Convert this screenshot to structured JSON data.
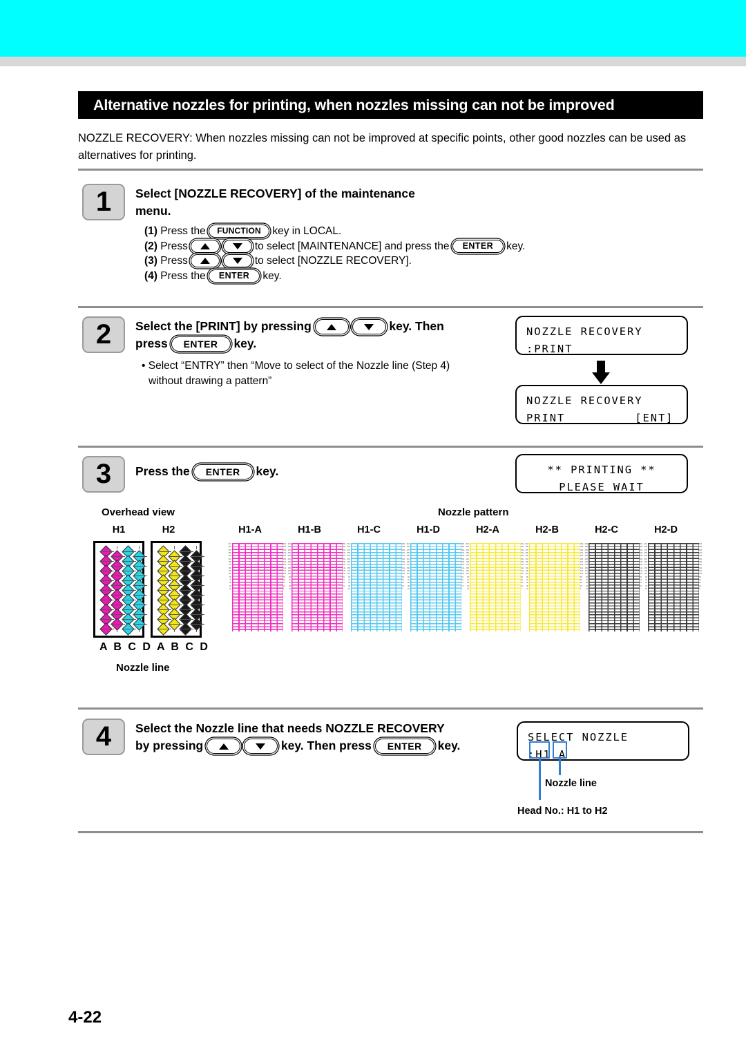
{
  "page": {
    "number": "4-22",
    "title": "Alternative nozzles for printing, when nozzles missing can not be improved",
    "intro": "NOZZLE RECOVERY: When nozzles missing can not be improved at specific points, other good nozzles can be used as alternatives for printing.",
    "banner_color": "#00ffff",
    "title_bg": "#000000",
    "accent_blue": "#2e7fd4"
  },
  "keys": {
    "function": "FUNCTION",
    "enter": "ENTER",
    "up": "▲",
    "down": "▼"
  },
  "steps": [
    {
      "num": "1",
      "heading_line1": "Select   [NOZZLE   RECOVERY]   of   the   maintenance",
      "heading_line2": "menu.",
      "substeps": [
        {
          "n": "(1)",
          "pre": "Press the",
          "key": "FUNCTION",
          "post": "key in LOCAL."
        },
        {
          "n": "(2)",
          "pre": "Press",
          "key": "arrows",
          "mid": "to select [MAINTENANCE] and press the",
          "key2": "ENTER",
          "post": "key."
        },
        {
          "n": "(3)",
          "pre": "Press",
          "key": "arrows",
          "post": "to select [NOZZLE RECOVERY]."
        },
        {
          "n": "(4)",
          "pre": "Press the",
          "key": "ENTER",
          "post": "key."
        }
      ]
    },
    {
      "num": "2",
      "heading_pre": "Select the [PRINT] by pressing",
      "heading_mid": "key.   Then",
      "heading_line2_pre": "press",
      "heading_line2_post": "key.",
      "note_line1": "• Select “ENTRY” then “Move  to  select  of  the  Nozzle  line  (Step  4)",
      "note_line2": "without drawing a pattern”",
      "lcd1": {
        "line1": "NOZZLE RECOVERY",
        "line2": ":PRINT"
      },
      "lcd2": {
        "line1": "NOZZLE RECOVERY",
        "line2": "PRINT         [ENT]"
      }
    },
    {
      "num": "3",
      "heading_pre": "Press the",
      "heading_post": "key.",
      "lcd": {
        "line1": "** PRINTING **",
        "line2": "PLEASE WAIT"
      }
    },
    {
      "num": "4",
      "heading_line1": "Select the Nozzle line that needs NOZZLE RECOVERY",
      "heading_line2_pre": "by pressing",
      "heading_line2_mid": "key. Then press",
      "heading_line2_post": "key.",
      "lcd": {
        "line1": "SELECT NOZZLE",
        "line2": ":H1 A"
      },
      "callouts": {
        "nozzle_line": "Nozzle line",
        "head_no": "Head No.: H1 to H2",
        "highlight_head": "H1",
        "highlight_line": "A"
      }
    }
  ],
  "figure": {
    "overhead_caption": "Overhead view",
    "pattern_caption": "Nozzle pattern",
    "nozzle_line_caption": "Nozzle line",
    "heads": [
      {
        "label": "H1",
        "abcd": "A B C D",
        "columns": [
          {
            "line": "A",
            "color": "#ea18b4"
          },
          {
            "line": "B",
            "color": "#ea18b4"
          },
          {
            "line": "C",
            "color": "#2ad4e8"
          },
          {
            "line": "D",
            "color": "#2ad4e8"
          }
        ]
      },
      {
        "label": "H2",
        "abcd": "A B C D",
        "columns": [
          {
            "line": "A",
            "color": "#f2e616"
          },
          {
            "line": "B",
            "color": "#f2e616"
          },
          {
            "line": "C",
            "color": "#1a1a1a"
          },
          {
            "line": "D",
            "color": "#1a1a1a"
          }
        ]
      }
    ],
    "patterns": [
      {
        "label": "H1-A",
        "color": "#ef2fbe"
      },
      {
        "label": "H1-B",
        "color": "#ef2fbe"
      },
      {
        "label": "H1-C",
        "color": "#55c8f0"
      },
      {
        "label": "H1-D",
        "color": "#55c8f0"
      },
      {
        "label": "H2-A",
        "color": "#f7e93c"
      },
      {
        "label": "H2-B",
        "color": "#f7e93c"
      },
      {
        "label": "H2-C",
        "color": "#3a3a3a"
      },
      {
        "label": "H2-D",
        "color": "#3a3a3a"
      }
    ],
    "scale_numbers": [
      "310",
      "290",
      "270",
      "250",
      "230",
      "210",
      "190",
      "170",
      "150",
      "130",
      "110",
      "90",
      "70",
      "50",
      "30",
      "10"
    ],
    "scale_numbers_right": [
      "301",
      "281",
      "261",
      "241",
      "221",
      "201",
      "181",
      "161",
      "141",
      "121",
      "101",
      "81",
      "61",
      "41",
      "21",
      "1"
    ]
  }
}
